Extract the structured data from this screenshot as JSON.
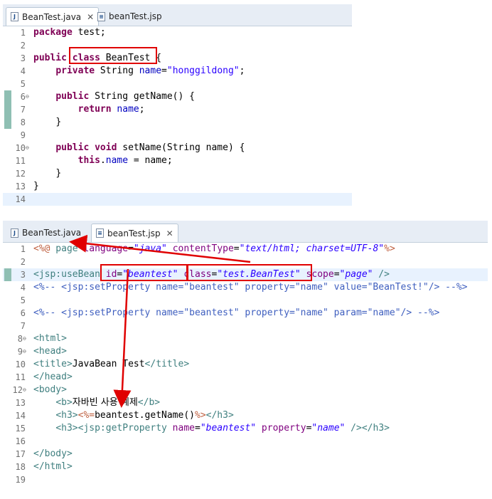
{
  "colors": {
    "keyword": "#7f0055",
    "field": "#0000c0",
    "string": "#2a00ff",
    "tag": "#3f7f7f",
    "attribute": "#7f007f",
    "comment": "#3f5fbf",
    "jsp_delimiter": "#bf5f3f",
    "annotation_red": "#e00000",
    "current_line": "#e8f2fe"
  },
  "pane1": {
    "tabs": [
      {
        "label": "BeanTest.java",
        "icon": "java-file-icon",
        "close": "✕"
      },
      {
        "label": "beanTest.jsp",
        "icon": "jsp-file-icon"
      }
    ],
    "lines": [
      {
        "n": "1"
      },
      {
        "n": "2"
      },
      {
        "n": "3"
      },
      {
        "n": "4"
      },
      {
        "n": "5"
      },
      {
        "n": "6"
      },
      {
        "n": "7"
      },
      {
        "n": "8"
      },
      {
        "n": "9"
      },
      {
        "n": "10"
      },
      {
        "n": "11"
      },
      {
        "n": "12"
      },
      {
        "n": "13"
      },
      {
        "n": "14"
      }
    ],
    "code": {
      "l1_kw": "package",
      "l1_rest": " test;",
      "l3_kw1": "public",
      "l3_kw2": "class",
      "l3_rest": " BeanTest {",
      "l4_kw": "private",
      "l4_type": " String ",
      "l4_field": "name",
      "l4_eq": "=",
      "l4_str": "\"honggildong\"",
      "l4_end": ";",
      "l6_kw": "public",
      "l6_rest": " String getName() {",
      "l7_kw": "return",
      "l7_field": "name",
      "l7_end": ";",
      "l8": "}",
      "l10_kw1": "public",
      "l10_kw2": "void",
      "l10_rest": " setName(String name) {",
      "l11_kw": "this",
      "l11_dot": ".",
      "l11_field": "name",
      "l11_rest": " = name;",
      "l12": "}",
      "l13": "}"
    }
  },
  "pane2": {
    "tabs": [
      {
        "label": "BeanTest.java",
        "icon": "java-file-icon"
      },
      {
        "label": "beanTest.jsp",
        "icon": "jsp-file-icon",
        "close": "✕"
      }
    ],
    "lines": [
      {
        "n": "1"
      },
      {
        "n": "2"
      },
      {
        "n": "3"
      },
      {
        "n": "4"
      },
      {
        "n": "5"
      },
      {
        "n": "6"
      },
      {
        "n": "7"
      },
      {
        "n": "8"
      },
      {
        "n": "9"
      },
      {
        "n": "10"
      },
      {
        "n": "11"
      },
      {
        "n": "12"
      },
      {
        "n": "13"
      },
      {
        "n": "14"
      },
      {
        "n": "15"
      },
      {
        "n": "16"
      },
      {
        "n": "17"
      },
      {
        "n": "18"
      },
      {
        "n": "19"
      }
    ],
    "code": {
      "l1_open": "<%@",
      "l1_page": " page ",
      "l1_a1": "language",
      "l1_eq1": "=",
      "l1_v1": "\"java\"",
      "l1_a2": " contentType",
      "l1_eq2": "=",
      "l1_v2": "\"text/html; charset=UTF-8\"",
      "l1_close": "%>",
      "l3_tag": "<jsp:useBean",
      "l3_a1": " id",
      "l3_eq1": "=",
      "l3_v1": "\"beantest\"",
      "l3_a2": " class",
      "l3_eq2": "=",
      "l3_v2": "\"test.BeanTest\"",
      "l3_a3": " scope",
      "l3_eq3": "=",
      "l3_v3": "\"page\"",
      "l3_end": " />",
      "l4": "<%-- <jsp:setProperty name=\"beantest\" property=\"name\" value=\"BeanTest!\"/> --%>",
      "l6": "<%-- <jsp:setProperty name=\"beantest\" property=\"name\" param=\"name\"/> --%>",
      "l8": "<html>",
      "l9": "<head>",
      "l10_open": "<title>",
      "l10_text": "JavaBean Test",
      "l10_close": "</title>",
      "l11": "</head>",
      "l12": "<body>",
      "l13_open": "<b>",
      "l13_text": "자바빈 사용 예제",
      "l13_close": "</b>",
      "l14_open": "<h3>",
      "l14_jsp_open": "<%=",
      "l14_expr": "beantest.getName()",
      "l14_jsp_close": "%>",
      "l14_close": "</h3>",
      "l15_open": "<h3>",
      "l15_tag": "<jsp:getProperty",
      "l15_a1": " name",
      "l15_eq1": "=",
      "l15_v1": "\"beantest\"",
      "l15_a2": " property",
      "l15_eq2": "=",
      "l15_v2": "\"name\"",
      "l15_end": " />",
      "l15_close": "</h3>",
      "l17": "</body>",
      "l18": "</html>"
    }
  }
}
